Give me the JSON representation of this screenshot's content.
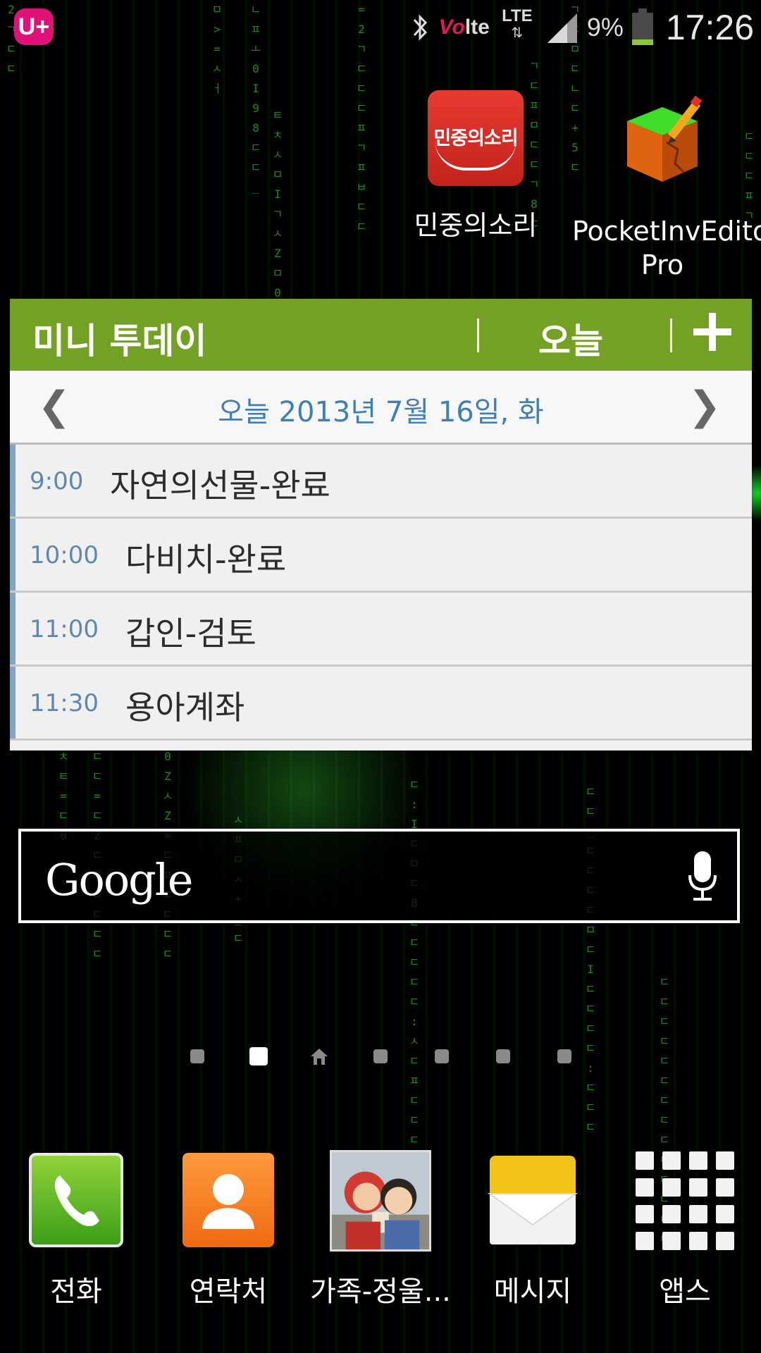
{
  "status_bar": {
    "carrier": "U+",
    "volte": "Vo",
    "volte_suffix": "lte",
    "network": "LTE",
    "network_arrows": "⇅",
    "battery_percent": "9%",
    "battery_level": 0.09,
    "time": "17:26"
  },
  "desktop_apps": [
    {
      "label": "민중의소리",
      "icon": "minjung-news-icon",
      "icon_text": "민중의소리"
    },
    {
      "label": "PocketInvEditor Pro",
      "icon": "cube-pencil-icon"
    }
  ],
  "mini_today": {
    "title": "미니 투데이",
    "today_button": "오늘",
    "add_button": "+",
    "prev": "❮",
    "next": "❯",
    "date": "오늘 2013년 7월 16일, 화",
    "events": [
      {
        "time": "9:00",
        "title": "자연의선물-완료"
      },
      {
        "time": "10:00",
        "title": "다비치-완료"
      },
      {
        "time": "11:00",
        "title": "갑인-검토"
      },
      {
        "time": "11:30",
        "title": "용아계좌"
      }
    ]
  },
  "google_search": {
    "logo": "Google",
    "mic_icon": "microphone-icon"
  },
  "page_indicator": {
    "count": 7,
    "current": 2,
    "home": 3
  },
  "dock": [
    {
      "label": "전화",
      "icon": "phone-icon"
    },
    {
      "label": "연락처",
      "icon": "contacts-icon"
    },
    {
      "label": "가족-정울...",
      "icon": "photo-icon"
    },
    {
      "label": "메시지",
      "icon": "message-icon"
    },
    {
      "label": "앱스",
      "icon": "apps-grid-icon"
    }
  ],
  "colors": {
    "widget_header": "#73a123",
    "date_text": "#3f7fb5",
    "carrier": "#e0127a"
  }
}
